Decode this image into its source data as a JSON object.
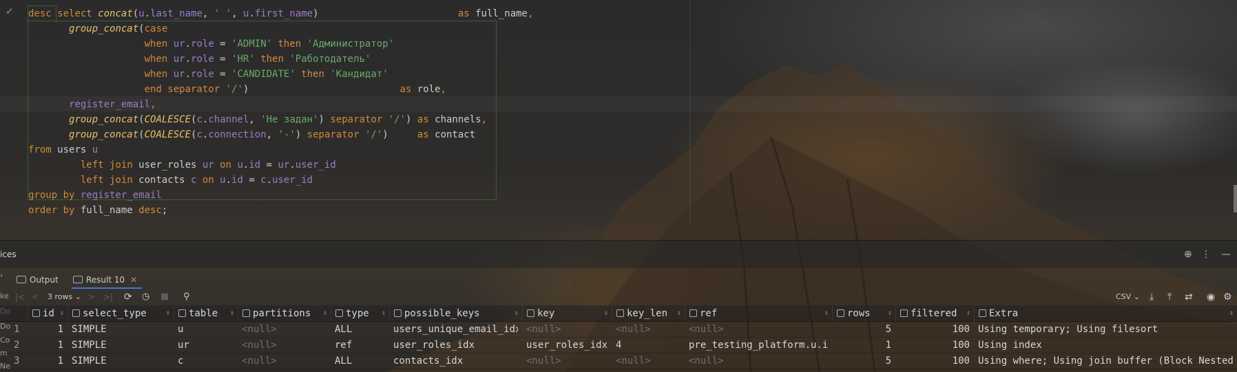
{
  "editor": {
    "status_check": "✓",
    "lines": [
      [
        [
          "kw",
          "desc "
        ],
        [
          "kw",
          "select "
        ],
        [
          "fn",
          "concat"
        ],
        [
          "",
          "("
        ],
        [
          "fld",
          "u"
        ],
        [
          "",
          "."
        ],
        [
          "fld",
          "last_name"
        ],
        [
          "",
          ", "
        ],
        [
          "str",
          "' '"
        ],
        [
          "",
          ", "
        ],
        [
          "fld",
          "u"
        ],
        [
          "",
          "."
        ],
        [
          "fld",
          "first_name"
        ],
        [
          "",
          ")                        "
        ],
        [
          "kw",
          "as "
        ],
        [
          "",
          "full_name"
        ],
        [
          "kw",
          ","
        ]
      ],
      [
        [
          "",
          "       "
        ],
        [
          "fn",
          "group_concat"
        ],
        [
          "",
          "("
        ],
        [
          "kw",
          "case"
        ]
      ],
      [
        [
          "",
          "                    "
        ],
        [
          "kw",
          "when "
        ],
        [
          "fld",
          "ur"
        ],
        [
          "",
          "."
        ],
        [
          "fld",
          "role"
        ],
        [
          "",
          " = "
        ],
        [
          "str",
          "'ADMIN'"
        ],
        [
          "kw",
          " then "
        ],
        [
          "str",
          "'Администратор'"
        ]
      ],
      [
        [
          "",
          "                    "
        ],
        [
          "kw",
          "when "
        ],
        [
          "fld",
          "ur"
        ],
        [
          "",
          "."
        ],
        [
          "fld",
          "role"
        ],
        [
          "",
          " = "
        ],
        [
          "str",
          "'HR'"
        ],
        [
          "kw",
          " then "
        ],
        [
          "str",
          "'Работодатель'"
        ]
      ],
      [
        [
          "",
          "                    "
        ],
        [
          "kw",
          "when "
        ],
        [
          "fld",
          "ur"
        ],
        [
          "",
          "."
        ],
        [
          "fld",
          "role"
        ],
        [
          "",
          " = "
        ],
        [
          "str",
          "'CANDIDATE'"
        ],
        [
          "kw",
          " then "
        ],
        [
          "str",
          "'Кандидат'"
        ]
      ],
      [
        [
          "",
          "                    "
        ],
        [
          "kw",
          "end separator "
        ],
        [
          "str",
          "'/'"
        ],
        [
          "",
          ")                          "
        ],
        [
          "kw",
          "as "
        ],
        [
          "",
          "role"
        ],
        [
          "kw",
          ","
        ]
      ],
      [
        [
          "",
          "       "
        ],
        [
          "fld",
          "register_email"
        ],
        [
          "kw",
          ","
        ]
      ],
      [
        [
          "",
          "       "
        ],
        [
          "fn",
          "group_concat"
        ],
        [
          "",
          "("
        ],
        [
          "fn",
          "COALESCE"
        ],
        [
          "",
          "("
        ],
        [
          "fld",
          "c"
        ],
        [
          "",
          "."
        ],
        [
          "fld",
          "channel"
        ],
        [
          "",
          ", "
        ],
        [
          "str",
          "'Не задан'"
        ],
        [
          "",
          ") "
        ],
        [
          "kw",
          "separator "
        ],
        [
          "str",
          "'/'"
        ],
        [
          "",
          ") "
        ],
        [
          "kw",
          "as "
        ],
        [
          "",
          "channels"
        ],
        [
          "kw",
          ","
        ]
      ],
      [
        [
          "",
          "       "
        ],
        [
          "fn",
          "group_concat"
        ],
        [
          "",
          "("
        ],
        [
          "fn",
          "COALESCE"
        ],
        [
          "",
          "("
        ],
        [
          "fld",
          "c"
        ],
        [
          "",
          "."
        ],
        [
          "fld",
          "connection"
        ],
        [
          "",
          ", "
        ],
        [
          "str",
          "'-'"
        ],
        [
          "",
          ") "
        ],
        [
          "kw",
          "separator "
        ],
        [
          "str",
          "'/'"
        ],
        [
          "",
          ")     "
        ],
        [
          "kw",
          "as "
        ],
        [
          "",
          "contact"
        ]
      ],
      [
        [
          "kw",
          "from "
        ],
        [
          "",
          "users "
        ],
        [
          "fld",
          "u"
        ]
      ],
      [
        [
          "",
          "         "
        ],
        [
          "kw",
          "left join "
        ],
        [
          "",
          "user_roles "
        ],
        [
          "fld",
          "ur"
        ],
        [
          "kw",
          " on "
        ],
        [
          "fld",
          "u"
        ],
        [
          "",
          "."
        ],
        [
          "fld",
          "id"
        ],
        [
          "",
          " = "
        ],
        [
          "fld",
          "ur"
        ],
        [
          "",
          "."
        ],
        [
          "fld",
          "user_id"
        ]
      ],
      [
        [
          "",
          "         "
        ],
        [
          "kw",
          "left join "
        ],
        [
          "",
          "contacts "
        ],
        [
          "fld",
          "c"
        ],
        [
          "kw",
          " on "
        ],
        [
          "fld",
          "u"
        ],
        [
          "",
          "."
        ],
        [
          "fld",
          "id"
        ],
        [
          "",
          " = "
        ],
        [
          "fld",
          "c"
        ],
        [
          "",
          "."
        ],
        [
          "fld",
          "user_id"
        ]
      ],
      [
        [
          "kw",
          "group by "
        ],
        [
          "fld",
          "register_email"
        ]
      ],
      [
        [
          "kw",
          "order by "
        ],
        [
          "",
          "full_name "
        ],
        [
          "kw",
          "desc"
        ],
        [
          "",
          ";"
        ]
      ]
    ]
  },
  "panel": {
    "title": "ices",
    "tabs": [
      {
        "label": "Output",
        "active": false
      },
      {
        "label": "Result 10",
        "active": true
      }
    ],
    "close_glyph": "✕",
    "side_stubs": [
      "ke",
      "Do",
      "Do",
      "Co",
      "m",
      "Ne"
    ]
  },
  "toolbar": {
    "first": "|<",
    "prev": "<",
    "rows_label": "3 rows",
    "next": ">",
    "last": ">|",
    "format": "CSV"
  },
  "grid": {
    "columns": [
      "id",
      "select_type",
      "table",
      "partitions",
      "type",
      "possible_keys",
      "key",
      "key_len",
      "ref",
      "rows",
      "filtered",
      "Extra"
    ],
    "rows": [
      {
        "n": "1",
        "cells": [
          "1",
          "SIMPLE",
          "u",
          "<null>",
          "ALL",
          "users_unique_email_idx",
          "<null>",
          "<null>",
          "<null>",
          "5",
          "100",
          "Using temporary; Using filesort"
        ]
      },
      {
        "n": "2",
        "cells": [
          "1",
          "SIMPLE",
          "ur",
          "<null>",
          "ref",
          "user_roles_idx",
          "user_roles_idx",
          "4",
          "pre_testing_platform.u.id",
          "1",
          "100",
          "Using index"
        ]
      },
      {
        "n": "3",
        "cells": [
          "1",
          "SIMPLE",
          "c",
          "<null>",
          "ALL",
          "contacts_idx",
          "<null>",
          "<null>",
          "<null>",
          "5",
          "100",
          "Using where; Using join buffer (Block Nested Loop)"
        ]
      }
    ]
  }
}
